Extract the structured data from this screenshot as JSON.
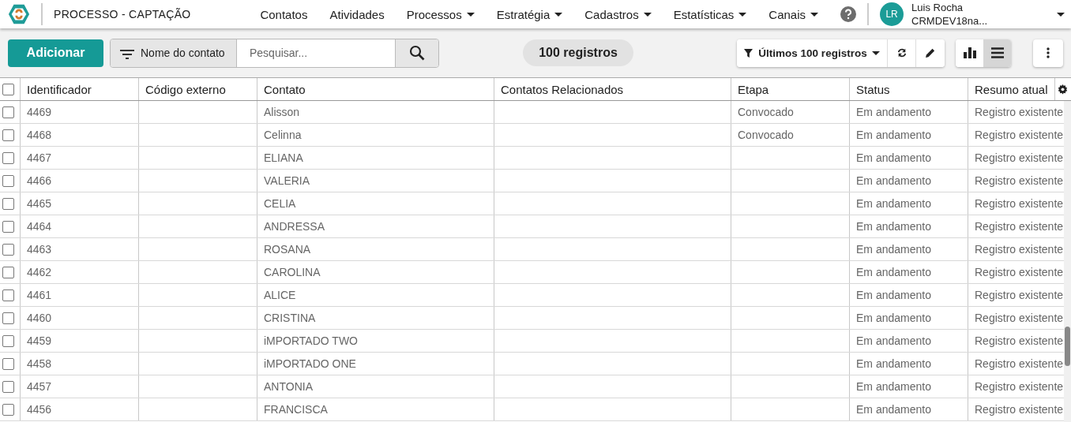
{
  "header": {
    "title": "PROCESSO - CAPTAÇÃO",
    "nav": [
      {
        "label": "Contatos",
        "dropdown": false
      },
      {
        "label": "Atividades",
        "dropdown": false
      },
      {
        "label": "Processos",
        "dropdown": true
      },
      {
        "label": "Estratégia",
        "dropdown": true
      },
      {
        "label": "Cadastros",
        "dropdown": true
      },
      {
        "label": "Estatísticas",
        "dropdown": true
      },
      {
        "label": "Canais",
        "dropdown": true
      }
    ],
    "user": {
      "initials": "LR",
      "name": "Luis Rocha",
      "org": "CRMDEV18na..."
    }
  },
  "toolbar": {
    "add_button": "Adicionar",
    "filter_field": "Nome do contato",
    "search": {
      "placeholder": "Pesquisar..."
    },
    "count": "100 registros",
    "saved_filter": "Últimos 100 registros",
    "views": [
      {
        "kind": "chart",
        "selected": false
      },
      {
        "kind": "list",
        "selected": true
      }
    ]
  },
  "table": {
    "select_all_checked": false,
    "columns": [
      "Identificador",
      "Código externo",
      "Contato",
      "Contatos Relacionados",
      "Etapa",
      "Status",
      "Resumo atual"
    ],
    "rows": [
      {
        "checked": false,
        "cells": [
          "4469",
          "",
          "Alisson",
          "",
          "Convocado",
          "Em andamento",
          "Registro existente"
        ]
      },
      {
        "checked": false,
        "cells": [
          "4468",
          "",
          "Celinna",
          "",
          "Convocado",
          "Em andamento",
          "Registro existente"
        ]
      },
      {
        "checked": false,
        "cells": [
          "4467",
          "",
          "ELIANA",
          "",
          "",
          "Em andamento",
          "Registro existente"
        ]
      },
      {
        "checked": false,
        "cells": [
          "4466",
          "",
          "VALERIA",
          "",
          "",
          "Em andamento",
          "Registro existente"
        ]
      },
      {
        "checked": false,
        "cells": [
          "4465",
          "",
          "CELIA",
          "",
          "",
          "Em andamento",
          "Registro existente"
        ]
      },
      {
        "checked": false,
        "cells": [
          "4464",
          "",
          "ANDRESSA",
          "",
          "",
          "Em andamento",
          "Registro existente"
        ]
      },
      {
        "checked": false,
        "cells": [
          "4463",
          "",
          "ROSANA",
          "",
          "",
          "Em andamento",
          "Registro existente"
        ]
      },
      {
        "checked": false,
        "cells": [
          "4462",
          "",
          "CAROLINA",
          "",
          "",
          "Em andamento",
          "Registro existente"
        ]
      },
      {
        "checked": false,
        "cells": [
          "4461",
          "",
          "ALICE",
          "",
          "",
          "Em andamento",
          "Registro existente"
        ]
      },
      {
        "checked": false,
        "cells": [
          "4460",
          "",
          "CRISTINA",
          "",
          "",
          "Em andamento",
          "Registro existente"
        ]
      },
      {
        "checked": false,
        "cells": [
          "4459",
          "",
          "iMPORTADO TWO",
          "",
          "",
          "Em andamento",
          "Registro existente"
        ]
      },
      {
        "checked": false,
        "cells": [
          "4458",
          "",
          "iMPORTADO ONE",
          "",
          "",
          "Em andamento",
          "Registro existente"
        ]
      },
      {
        "checked": false,
        "cells": [
          "4457",
          "",
          "ANTONIA",
          "",
          "",
          "Em andamento",
          "Registro existente"
        ]
      },
      {
        "checked": false,
        "cells": [
          "4456",
          "",
          "FRANCISCA",
          "",
          "",
          "Em andamento",
          "Registro existente"
        ]
      }
    ]
  }
}
